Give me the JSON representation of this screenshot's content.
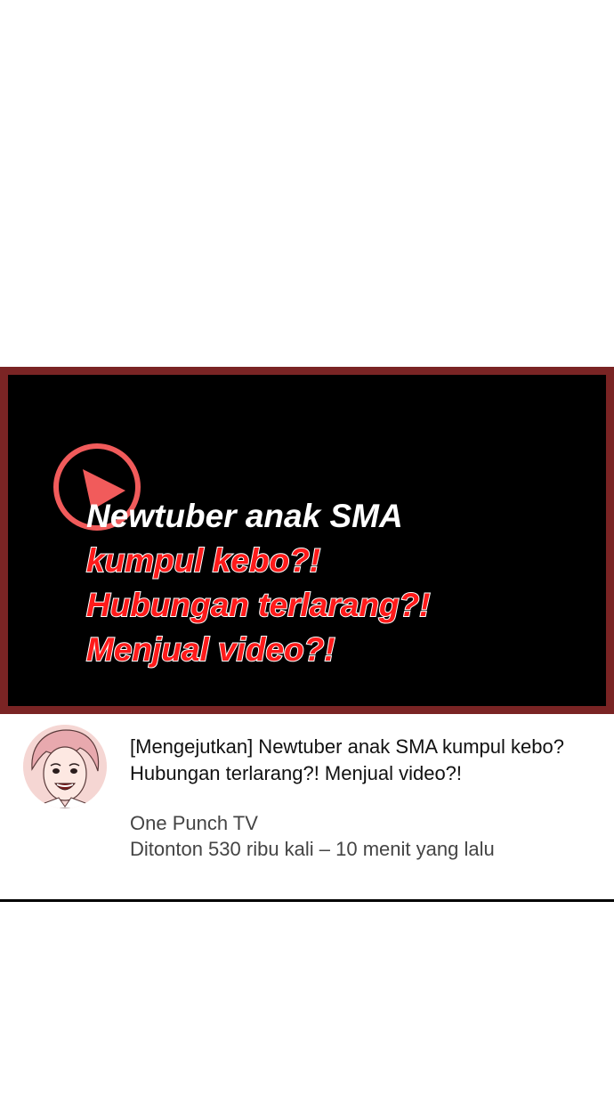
{
  "thumbnail": {
    "headline_line1": "Newtuber anak SMA",
    "headline_line2": "kumpul kebo?!",
    "headline_line3": "Hubungan terlarang?!",
    "headline_line4": "Menjual video?!",
    "frame_color": "#7a2424",
    "accent_color": "#ff1a1a",
    "icon": "play-icon"
  },
  "video": {
    "title": "[Mengejutkan] Newtuber anak SMA kumpul kebo? Hubungan terlarang?! Menjual video?!",
    "channel": "One Punch TV",
    "stats": "Ditonton 530 ribu kali – 10 menit yang lalu"
  }
}
